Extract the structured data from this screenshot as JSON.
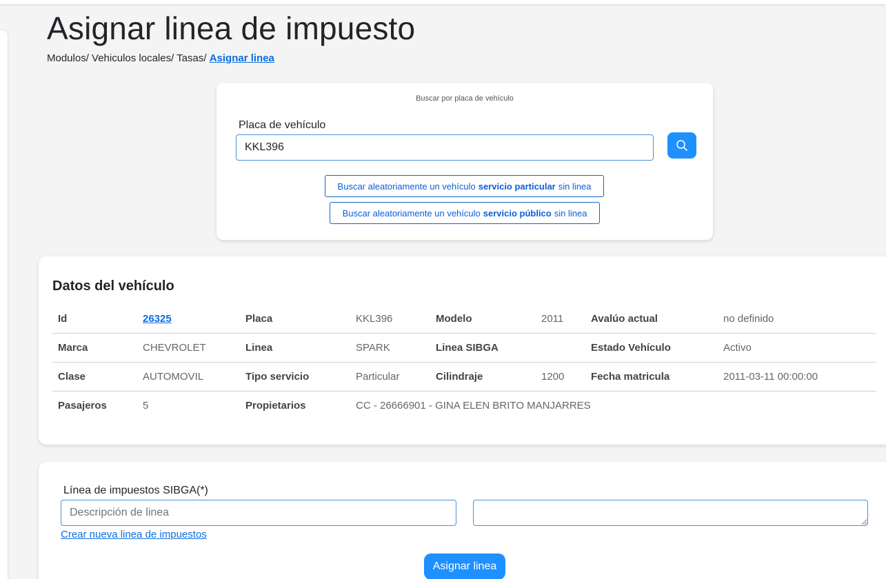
{
  "page": {
    "title": "Asignar linea de impuesto",
    "breadcrumb": {
      "path": "Modulos/ Vehiculos locales/ Tasas/ ",
      "current": "Asignar linea"
    }
  },
  "search": {
    "caption": "Buscar por placa de vehículo",
    "plate_label": "Placa de vehículo",
    "plate_value": "KKL396",
    "search_icon": "search-icon",
    "random_particular": {
      "prefix": "Buscar aleatoriamente un vehículo",
      "bold": "servicio particular",
      "suffix": "sin linea"
    },
    "random_publico": {
      "prefix": "Buscar aleatoriamente un vehículo",
      "bold": "servicio público",
      "suffix": "sin linea"
    }
  },
  "vehicle": {
    "title": "Datos del vehículo",
    "rows": [
      [
        {
          "label": "Id",
          "value": "26325"
        },
        {
          "label": "Placa",
          "value": "KKL396"
        },
        {
          "label": "Modelo",
          "value": "2011"
        },
        {
          "label": "Avalúo actual",
          "value": "no definido"
        }
      ],
      [
        {
          "label": "Marca",
          "value": "CHEVROLET"
        },
        {
          "label": "Linea",
          "value": "SPARK"
        },
        {
          "label": "Linea SIBGA",
          "value": ""
        },
        {
          "label": "Estado Vehículo",
          "value": "Activo"
        }
      ],
      [
        {
          "label": "Clase",
          "value": "AUTOMOVIL"
        },
        {
          "label": "Tipo servicio",
          "value": "Particular"
        },
        {
          "label": "Cilindraje",
          "value": "1200"
        },
        {
          "label": "Fecha matricula",
          "value": "2011-03-11 00:00:00"
        }
      ],
      [
        {
          "label": "Pasajeros",
          "value": "5"
        },
        {
          "label": "Propietarios",
          "value": "CC - 26666901 - GINA ELEN BRITO MANJARRES"
        }
      ]
    ]
  },
  "assign": {
    "line_label": "Línea de impuestos SIBGA(*)",
    "desc_placeholder": "Descripción de linea",
    "desc_value": "",
    "textarea_value": "",
    "create_link": "Crear nueva linea de impuestos",
    "assign_button": "Asignar linea"
  },
  "colors": {
    "primary": "#1e90ff",
    "link": "#0b6ee0",
    "background": "#f4f4f4"
  }
}
